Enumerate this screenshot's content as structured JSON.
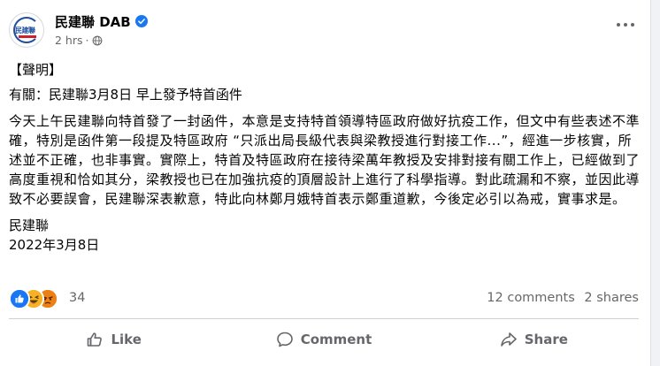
{
  "post": {
    "page_name": "民建聯 DAB",
    "time": "2 hrs",
    "separator": "·",
    "avatar_text": "民建聯",
    "icons": {
      "verified": "verified-badge-icon",
      "privacy": "globe-icon",
      "more": "more-options-icon"
    },
    "colors": {
      "verified": "#1877f2",
      "brand_blue": "#1d4f9c",
      "brand_red": "#d0202a"
    },
    "lines": {
      "heading": "【聲明】",
      "subject": "有關：民建聯3月8日 早上發予特首函件",
      "paragraph": "今天上午民建聯向特首發了一封函件，本意是支持特首領導特區政府做好抗疫工作，但文中有些表述不準確，特別是函件第一段提及特區政府 “只派出局長級代表與梁教授進行對接工作...”，經進一步核實，所述並不正確，也非事實。實際上，特首及特區政府在接待梁萬年教授及安排對接有關工作上，已經做到了高度重視和恰如其分，梁教授也已在加強抗疫的頂層設計上進行了科學指導。對此疏漏和不察，並因此導致不必要誤會，民建聯深表歉意，特此向林鄭月娥特首表示鄭重道歉，今後定必引以為戒，實事求是。",
      "signature": "民建聯",
      "date": "2022年3月8日"
    }
  },
  "reactions": {
    "icons": [
      "like-reaction-icon",
      "haha-reaction-icon",
      "angry-reaction-icon"
    ],
    "count": "34",
    "comments": "12 comments",
    "shares": "2 shares"
  },
  "actions": {
    "like": "Like",
    "comment": "Comment",
    "share": "Share"
  }
}
